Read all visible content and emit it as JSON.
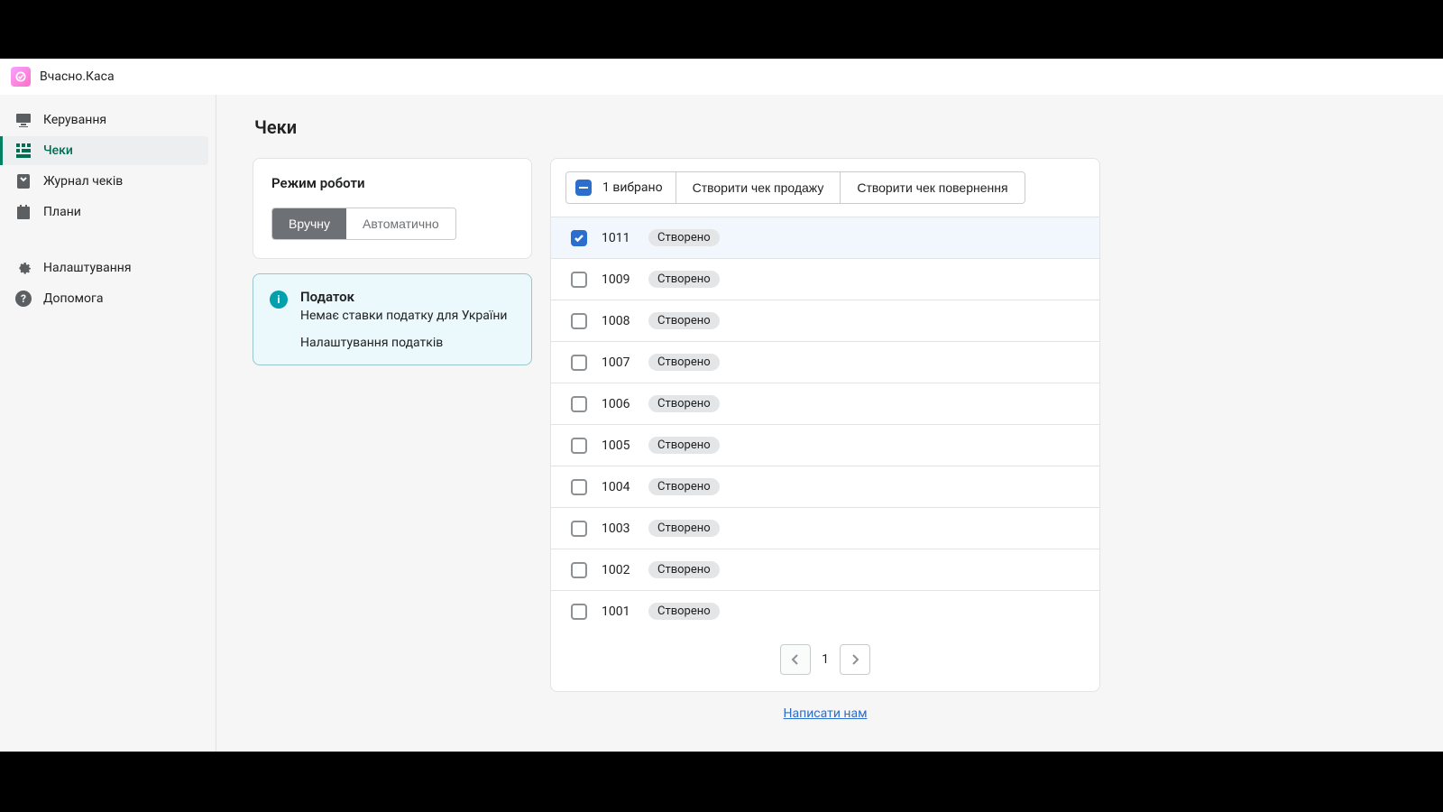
{
  "app": {
    "title": "Вчасно.Каса"
  },
  "sidebar": {
    "items": [
      {
        "label": "Керування",
        "icon": "management-icon"
      },
      {
        "label": "Чеки",
        "icon": "receipts-icon"
      },
      {
        "label": "Журнал чеків",
        "icon": "journal-icon"
      },
      {
        "label": "Плани",
        "icon": "plans-icon"
      }
    ],
    "bottom": [
      {
        "label": "Налаштування",
        "icon": "settings-icon"
      },
      {
        "label": "Допомога",
        "icon": "help-icon"
      }
    ],
    "active_index": 1
  },
  "page": {
    "title": "Чеки"
  },
  "mode_card": {
    "title": "Режим роботи",
    "options": {
      "manual": "Вручну",
      "auto": "Автоматично"
    }
  },
  "info_card": {
    "title": "Податок",
    "text": "Немає ставки податку для України",
    "action": "Налаштування податків"
  },
  "toolbar": {
    "selected_count": "1 вибрано",
    "create_sale": "Створити чек продажу",
    "create_return": "Створити чек повернення"
  },
  "status_label": "Створено",
  "rows": [
    {
      "id": "1011",
      "checked": true
    },
    {
      "id": "1009",
      "checked": false
    },
    {
      "id": "1008",
      "checked": false
    },
    {
      "id": "1007",
      "checked": false
    },
    {
      "id": "1006",
      "checked": false
    },
    {
      "id": "1005",
      "checked": false
    },
    {
      "id": "1004",
      "checked": false
    },
    {
      "id": "1003",
      "checked": false
    },
    {
      "id": "1002",
      "checked": false
    },
    {
      "id": "1001",
      "checked": false
    }
  ],
  "pagination": {
    "page": "1"
  },
  "footer": {
    "contact": "Написати нам"
  }
}
